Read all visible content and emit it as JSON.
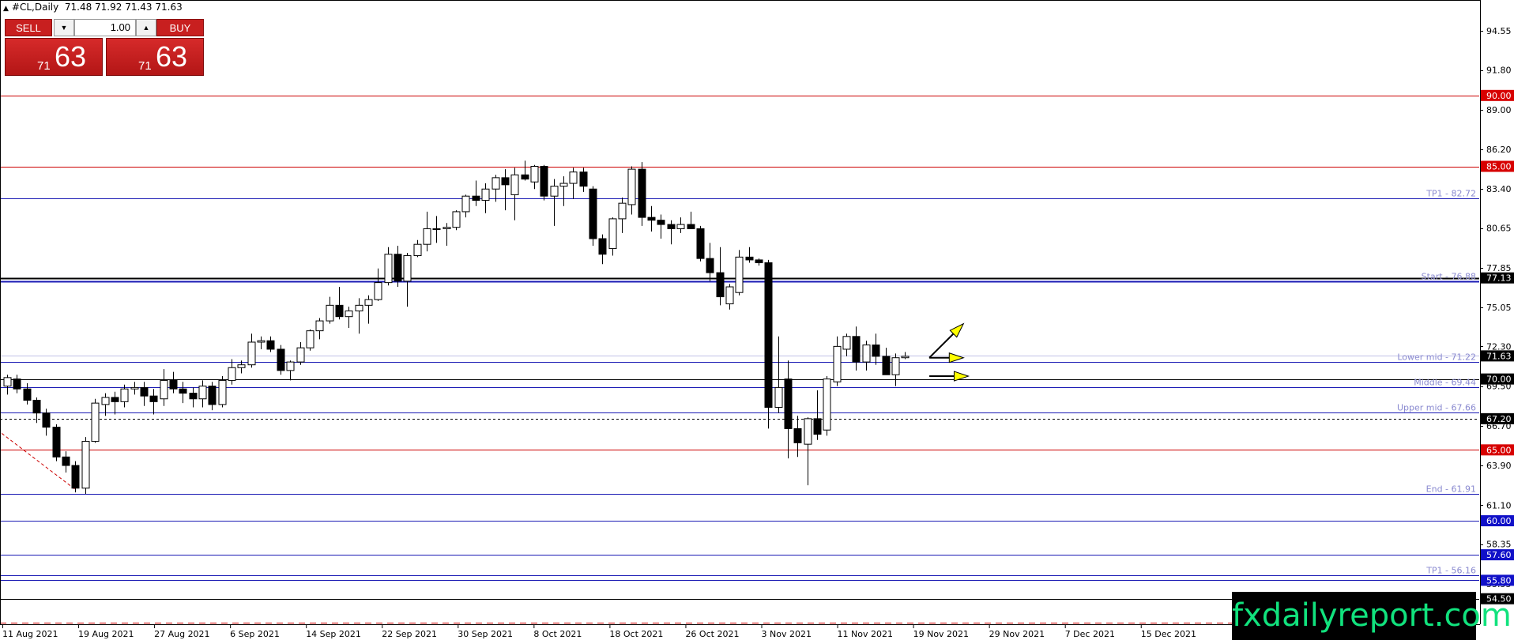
{
  "header": {
    "symbol_label": "#CL,Daily",
    "ohlc_text": "71.48 71.92 71.43 71.63"
  },
  "trade_panel": {
    "sell_label": "SELL",
    "buy_label": "BUY",
    "volume": "1.00",
    "sell_price_small": "71",
    "sell_price_big": "63",
    "buy_price_small": "71",
    "buy_price_big": "63"
  },
  "branding": {
    "watermark": "fxdailyreport.com"
  },
  "colors": {
    "up_candle_fill": "#ffffff",
    "down_candle_fill": "#000000",
    "red_level": "#cc0000",
    "blue_level": "#1a1ab4",
    "label_text": "#8a8ad0",
    "arrow_fill": "#ffff00"
  },
  "chart_data": {
    "type": "candlestick",
    "y_axis": {
      "ylim": [
        52.7,
        96.4
      ],
      "tick_labels": [
        "94.55",
        "91.80",
        "89.00",
        "86.20",
        "83.40",
        "80.65",
        "77.85",
        "75.05",
        "72.30",
        "69.50",
        "66.70",
        "63.90",
        "61.10",
        "58.35",
        "55.55"
      ]
    },
    "x_axis": {
      "tick_labels": [
        "11 Aug 2021",
        "19 Aug 2021",
        "27 Aug 2021",
        "6 Sep 2021",
        "14 Sep 2021",
        "22 Sep 2021",
        "30 Sep 2021",
        "8 Oct 2021",
        "18 Oct 2021",
        "26 Oct 2021",
        "3 Nov 2021",
        "11 Nov 2021",
        "19 Nov 2021",
        "29 Nov 2021",
        "7 Dec 2021",
        "15 Dec 2021"
      ]
    },
    "candles": [
      {
        "o": 69.5,
        "h": 70.3,
        "l": 68.9,
        "c": 70.1
      },
      {
        "o": 70.0,
        "h": 70.3,
        "l": 69.0,
        "c": 69.3
      },
      {
        "o": 69.3,
        "h": 69.7,
        "l": 68.2,
        "c": 68.5
      },
      {
        "o": 68.5,
        "h": 68.7,
        "l": 66.9,
        "c": 67.6
      },
      {
        "o": 67.6,
        "h": 67.9,
        "l": 66.0,
        "c": 66.6
      },
      {
        "o": 66.6,
        "h": 66.8,
        "l": 64.2,
        "c": 64.5
      },
      {
        "o": 64.5,
        "h": 64.9,
        "l": 63.4,
        "c": 63.9
      },
      {
        "o": 63.9,
        "h": 64.2,
        "l": 62.0,
        "c": 62.3
      },
      {
        "o": 62.3,
        "h": 65.9,
        "l": 61.9,
        "c": 65.6
      },
      {
        "o": 65.6,
        "h": 68.6,
        "l": 65.5,
        "c": 68.3
      },
      {
        "o": 68.2,
        "h": 69.0,
        "l": 67.4,
        "c": 68.7
      },
      {
        "o": 68.7,
        "h": 69.1,
        "l": 67.5,
        "c": 68.4
      },
      {
        "o": 68.4,
        "h": 69.6,
        "l": 68.0,
        "c": 69.3
      },
      {
        "o": 69.3,
        "h": 69.8,
        "l": 68.9,
        "c": 69.4
      },
      {
        "o": 69.4,
        "h": 69.8,
        "l": 68.1,
        "c": 68.8
      },
      {
        "o": 68.8,
        "h": 69.3,
        "l": 67.5,
        "c": 68.4
      },
      {
        "o": 68.6,
        "h": 70.7,
        "l": 68.1,
        "c": 69.9
      },
      {
        "o": 69.9,
        "h": 70.5,
        "l": 69.0,
        "c": 69.3
      },
      {
        "o": 69.3,
        "h": 69.8,
        "l": 68.3,
        "c": 69.0
      },
      {
        "o": 69.0,
        "h": 69.4,
        "l": 68.0,
        "c": 68.6
      },
      {
        "o": 68.6,
        "h": 69.9,
        "l": 68.0,
        "c": 69.5
      },
      {
        "o": 69.5,
        "h": 69.8,
        "l": 67.8,
        "c": 68.2
      },
      {
        "o": 68.2,
        "h": 70.2,
        "l": 68.0,
        "c": 69.9
      },
      {
        "o": 69.9,
        "h": 71.4,
        "l": 69.6,
        "c": 70.8
      },
      {
        "o": 70.8,
        "h": 71.3,
        "l": 70.4,
        "c": 71.0
      },
      {
        "o": 71.0,
        "h": 73.2,
        "l": 70.8,
        "c": 72.6
      },
      {
        "o": 72.6,
        "h": 73.0,
        "l": 72.1,
        "c": 72.7
      },
      {
        "o": 72.7,
        "h": 73.0,
        "l": 71.9,
        "c": 72.1
      },
      {
        "o": 72.1,
        "h": 72.4,
        "l": 70.3,
        "c": 70.6
      },
      {
        "o": 70.6,
        "h": 71.3,
        "l": 69.9,
        "c": 71.2
      },
      {
        "o": 71.2,
        "h": 72.6,
        "l": 71.0,
        "c": 72.2
      },
      {
        "o": 72.2,
        "h": 73.5,
        "l": 72.0,
        "c": 73.4
      },
      {
        "o": 73.4,
        "h": 74.3,
        "l": 72.8,
        "c": 74.1
      },
      {
        "o": 74.1,
        "h": 75.8,
        "l": 73.9,
        "c": 75.2
      },
      {
        "o": 75.2,
        "h": 76.5,
        "l": 74.2,
        "c": 74.4
      },
      {
        "o": 74.4,
        "h": 75.1,
        "l": 73.6,
        "c": 74.8
      },
      {
        "o": 74.8,
        "h": 75.7,
        "l": 73.2,
        "c": 75.2
      },
      {
        "o": 75.2,
        "h": 75.9,
        "l": 73.9,
        "c": 75.6
      },
      {
        "o": 75.6,
        "h": 77.8,
        "l": 75.5,
        "c": 76.8
      },
      {
        "o": 76.8,
        "h": 79.3,
        "l": 76.6,
        "c": 78.8
      },
      {
        "o": 78.8,
        "h": 79.4,
        "l": 76.5,
        "c": 76.9
      },
      {
        "o": 76.9,
        "h": 78.9,
        "l": 75.1,
        "c": 78.7
      },
      {
        "o": 78.7,
        "h": 79.8,
        "l": 78.6,
        "c": 79.5
      },
      {
        "o": 79.5,
        "h": 81.8,
        "l": 79.0,
        "c": 80.6
      },
      {
        "o": 80.6,
        "h": 81.5,
        "l": 79.6,
        "c": 80.6
      },
      {
        "o": 80.6,
        "h": 81.0,
        "l": 79.4,
        "c": 80.7
      },
      {
        "o": 80.7,
        "h": 81.9,
        "l": 80.5,
        "c": 81.8
      },
      {
        "o": 81.8,
        "h": 83.0,
        "l": 81.4,
        "c": 82.9
      },
      {
        "o": 82.9,
        "h": 84.0,
        "l": 82.2,
        "c": 82.6
      },
      {
        "o": 82.6,
        "h": 83.8,
        "l": 81.7,
        "c": 83.4
      },
      {
        "o": 83.4,
        "h": 84.4,
        "l": 82.5,
        "c": 84.2
      },
      {
        "o": 84.2,
        "h": 84.8,
        "l": 81.9,
        "c": 83.7
      },
      {
        "o": 83.0,
        "h": 84.9,
        "l": 81.2,
        "c": 84.4
      },
      {
        "o": 84.4,
        "h": 85.4,
        "l": 84.0,
        "c": 84.1
      },
      {
        "o": 83.9,
        "h": 85.1,
        "l": 83.4,
        "c": 85.0
      },
      {
        "o": 85.0,
        "h": 85.1,
        "l": 82.6,
        "c": 82.9
      },
      {
        "o": 82.9,
        "h": 84.1,
        "l": 80.8,
        "c": 83.6
      },
      {
        "o": 83.6,
        "h": 84.3,
        "l": 82.2,
        "c": 83.8
      },
      {
        "o": 83.8,
        "h": 84.9,
        "l": 82.7,
        "c": 84.6
      },
      {
        "o": 84.6,
        "h": 84.9,
        "l": 83.2,
        "c": 83.6
      },
      {
        "o": 83.4,
        "h": 83.6,
        "l": 79.4,
        "c": 79.9
      },
      {
        "o": 79.9,
        "h": 80.2,
        "l": 78.1,
        "c": 78.8
      },
      {
        "o": 79.2,
        "h": 81.4,
        "l": 78.7,
        "c": 81.3
      },
      {
        "o": 81.3,
        "h": 82.8,
        "l": 80.3,
        "c": 82.4
      },
      {
        "o": 82.3,
        "h": 85.0,
        "l": 81.6,
        "c": 84.8
      },
      {
        "o": 84.8,
        "h": 85.3,
        "l": 80.8,
        "c": 81.4
      },
      {
        "o": 81.4,
        "h": 82.2,
        "l": 80.4,
        "c": 81.2
      },
      {
        "o": 81.2,
        "h": 81.6,
        "l": 79.9,
        "c": 80.9
      },
      {
        "o": 80.9,
        "h": 81.2,
        "l": 79.5,
        "c": 80.6
      },
      {
        "o": 80.6,
        "h": 81.4,
        "l": 80.3,
        "c": 80.9
      },
      {
        "o": 80.9,
        "h": 81.8,
        "l": 80.6,
        "c": 80.6
      },
      {
        "o": 80.6,
        "h": 80.8,
        "l": 78.3,
        "c": 78.5
      },
      {
        "o": 78.5,
        "h": 79.6,
        "l": 76.9,
        "c": 77.5
      },
      {
        "o": 77.5,
        "h": 79.3,
        "l": 75.2,
        "c": 75.8
      },
      {
        "o": 75.3,
        "h": 76.7,
        "l": 74.9,
        "c": 76.5
      },
      {
        "o": 76.1,
        "h": 79.1,
        "l": 75.9,
        "c": 78.6
      },
      {
        "o": 78.6,
        "h": 79.3,
        "l": 78.2,
        "c": 78.4
      },
      {
        "o": 78.4,
        "h": 78.5,
        "l": 78.0,
        "c": 78.2
      },
      {
        "o": 78.2,
        "h": 78.4,
        "l": 66.5,
        "c": 68.0
      },
      {
        "o": 68.0,
        "h": 73.0,
        "l": 67.6,
        "c": 69.4
      },
      {
        "o": 70.0,
        "h": 71.3,
        "l": 64.4,
        "c": 66.5
      },
      {
        "o": 66.5,
        "h": 67.4,
        "l": 64.5,
        "c": 65.5
      },
      {
        "o": 65.4,
        "h": 67.3,
        "l": 62.5,
        "c": 67.2
      },
      {
        "o": 67.2,
        "h": 69.2,
        "l": 65.7,
        "c": 66.1
      },
      {
        "o": 66.4,
        "h": 70.2,
        "l": 66.0,
        "c": 70.0
      },
      {
        "o": 69.8,
        "h": 73.0,
        "l": 69.5,
        "c": 72.3
      },
      {
        "o": 72.1,
        "h": 73.2,
        "l": 71.6,
        "c": 73.0
      },
      {
        "o": 73.0,
        "h": 73.7,
        "l": 70.6,
        "c": 71.2
      },
      {
        "o": 71.2,
        "h": 72.7,
        "l": 70.6,
        "c": 72.4
      },
      {
        "o": 72.4,
        "h": 73.2,
        "l": 71.0,
        "c": 71.6
      },
      {
        "o": 71.6,
        "h": 72.2,
        "l": 70.4,
        "c": 70.3
      },
      {
        "o": 70.3,
        "h": 71.8,
        "l": 69.5,
        "c": 71.5
      },
      {
        "o": 71.5,
        "h": 71.9,
        "l": 71.4,
        "c": 71.6
      }
    ],
    "horizontal_levels": [
      {
        "value": 90.0,
        "color": "#cc0000",
        "badge": "90.00",
        "badge_style": "red"
      },
      {
        "value": 85.0,
        "color": "#cc0000",
        "badge": "85.00",
        "badge_style": "red"
      },
      {
        "value": 82.72,
        "color": "#1a1ab4",
        "label": "TP1 - 82.72"
      },
      {
        "value": 77.13,
        "color": "#000000",
        "badge": "77.13",
        "badge_style": "black",
        "width": 2
      },
      {
        "value": 76.88,
        "color": "#1a1ab4",
        "label": "Start - 76.88",
        "width": 2
      },
      {
        "value": 71.63,
        "color": "#c0c0e8",
        "badge": "71.63",
        "badge_style": "black"
      },
      {
        "value": 71.22,
        "color": "#1a1ab4",
        "label": "Lower mid - 71.22"
      },
      {
        "value": 70.0,
        "color": "#000000",
        "badge": "70.00",
        "badge_style": "black"
      },
      {
        "value": 69.44,
        "color": "#1a1ab4",
        "label": "Middle - 69.44"
      },
      {
        "value": 67.66,
        "color": "#1a1ab4",
        "label": "Upper mid - 67.66"
      },
      {
        "value": 67.2,
        "color": "#000000",
        "badge": "67.20",
        "badge_style": "black",
        "dashed": true
      },
      {
        "value": 65.0,
        "color": "#cc0000",
        "badge": "65.00",
        "badge_style": "red"
      },
      {
        "value": 61.91,
        "color": "#1a1ab4",
        "label": "End - 61.91"
      },
      {
        "value": 60.0,
        "color": "#1a1ab4",
        "badge": "60.00",
        "badge_style": "blue"
      },
      {
        "value": 57.6,
        "color": "#1a1ab4",
        "badge": "57.60",
        "badge_style": "blue"
      },
      {
        "value": 56.16,
        "color": "#1a1ab4",
        "label": "TP1 - 56.16"
      },
      {
        "value": 55.8,
        "color": "#1a1ab4",
        "badge": "55.80",
        "badge_style": "blue"
      },
      {
        "value": 54.5,
        "color": "#000000",
        "badge": "54.50",
        "badge_style": "black"
      },
      {
        "value": 52.8,
        "color": "#cc0000",
        "dashed": true
      }
    ],
    "annotations": {
      "trend_line": {
        "from": {
          "index": -1,
          "value": 66.4
        },
        "to": {
          "index": 7,
          "value": 62.2
        },
        "color": "#cc0000",
        "dashed": true
      },
      "arrows": [
        {
          "from": {
            "index": 94.5,
            "value": 71.5
          },
          "to": {
            "index": 98,
            "value": 73.9
          }
        },
        {
          "from": {
            "index": 94.5,
            "value": 71.5
          },
          "to": {
            "index": 98,
            "value": 71.5
          }
        },
        {
          "from": {
            "index": 94.5,
            "value": 70.2
          },
          "to": {
            "index": 98.5,
            "value": 70.2
          }
        }
      ]
    }
  }
}
